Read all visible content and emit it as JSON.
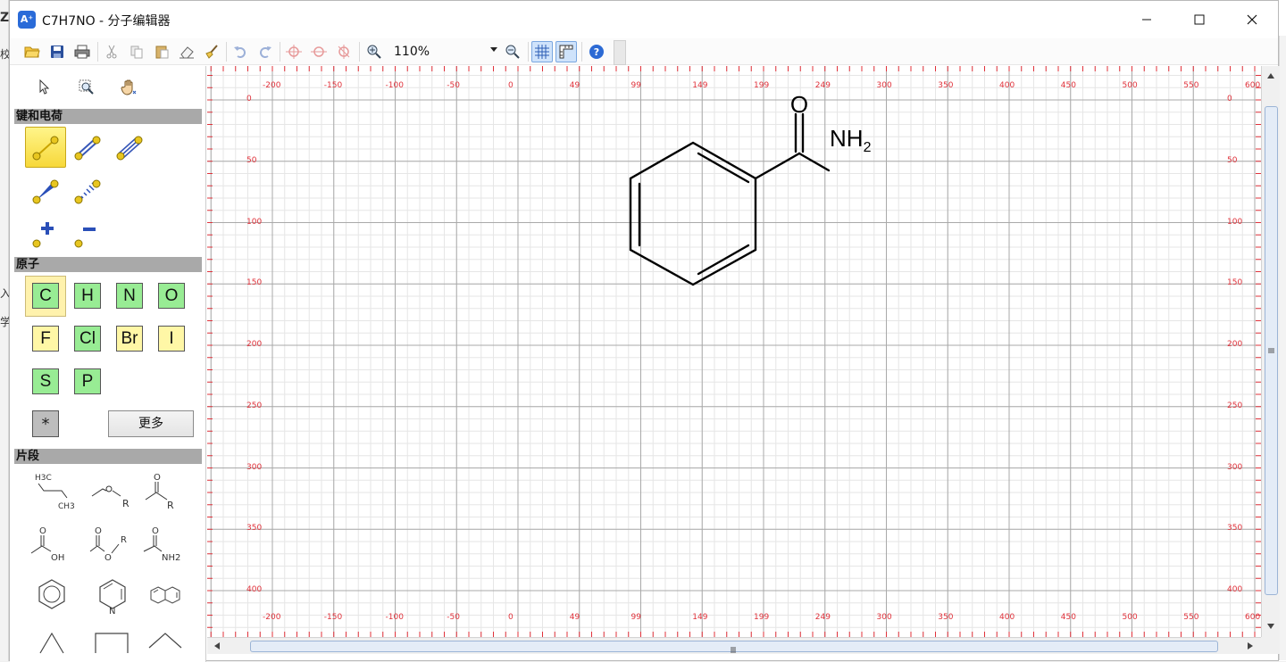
{
  "window": {
    "title": "C7H7NO - 分子编辑器",
    "app_icon_text": "A⁺"
  },
  "toolbar": {
    "zoom_value": "110%",
    "items": [
      "open-icon",
      "save-icon",
      "print-icon",
      "cut-icon",
      "copy-icon",
      "paste-icon",
      "eraser-icon",
      "clean-icon",
      "undo-icon",
      "redo-icon",
      "flip-horizontal-icon",
      "rotate-icon",
      "flip-vertical-icon",
      "zoom-in-icon",
      "zoom-out-icon",
      "grid-icon",
      "ruler-icon",
      "help-icon"
    ]
  },
  "palette": {
    "sections": {
      "bonds": "键和电荷",
      "atoms": "原子",
      "fragments": "片段"
    },
    "atoms": [
      {
        "symbol": "C",
        "color": "green"
      },
      {
        "symbol": "H",
        "color": "green"
      },
      {
        "symbol": "N",
        "color": "green"
      },
      {
        "symbol": "O",
        "color": "green"
      },
      {
        "symbol": "F",
        "color": "yellow"
      },
      {
        "symbol": "Cl",
        "color": "green"
      },
      {
        "symbol": "Br",
        "color": "yellow"
      },
      {
        "symbol": "I",
        "color": "yellow"
      },
      {
        "symbol": "S",
        "color": "green"
      },
      {
        "symbol": "P",
        "color": "green"
      }
    ],
    "star_label": "*",
    "more_label": "更多",
    "fragment_labels": {
      "ethyl_h3c": "H3C",
      "ethyl_ch3": "CH3",
      "ether_r": "R",
      "ketone_o": "O",
      "ketone_r": "R",
      "acid_o": "O",
      "acid_oh": "OH",
      "ester_o1": "O",
      "ester_o2": "O",
      "ester_r": "R",
      "amide_o": "O",
      "amide_nh2": "NH2",
      "pyridine_n": "N"
    }
  },
  "canvas": {
    "ruler_x": [
      "-200",
      "-150",
      "-100",
      "-50",
      "0",
      "49",
      "99",
      "149",
      "199",
      "249",
      "300",
      "350",
      "400",
      "450",
      "500",
      "550",
      "600"
    ],
    "ruler_y": [
      "0",
      "50",
      "100",
      "150",
      "200",
      "250",
      "300",
      "350",
      "400"
    ],
    "molecule": {
      "oxygen": "O",
      "amine": "NH",
      "amine_sub": "2"
    }
  },
  "colors": {
    "ruler_text": "#e0313a",
    "grid_major": "#a9a9a9",
    "grid_minor": "#e6e6e6",
    "section_header": "#a9a9a9",
    "atom_green": "#98ec94",
    "atom_yellow": "#fff7a6",
    "scroll_thumb": "#e4ecf7"
  }
}
